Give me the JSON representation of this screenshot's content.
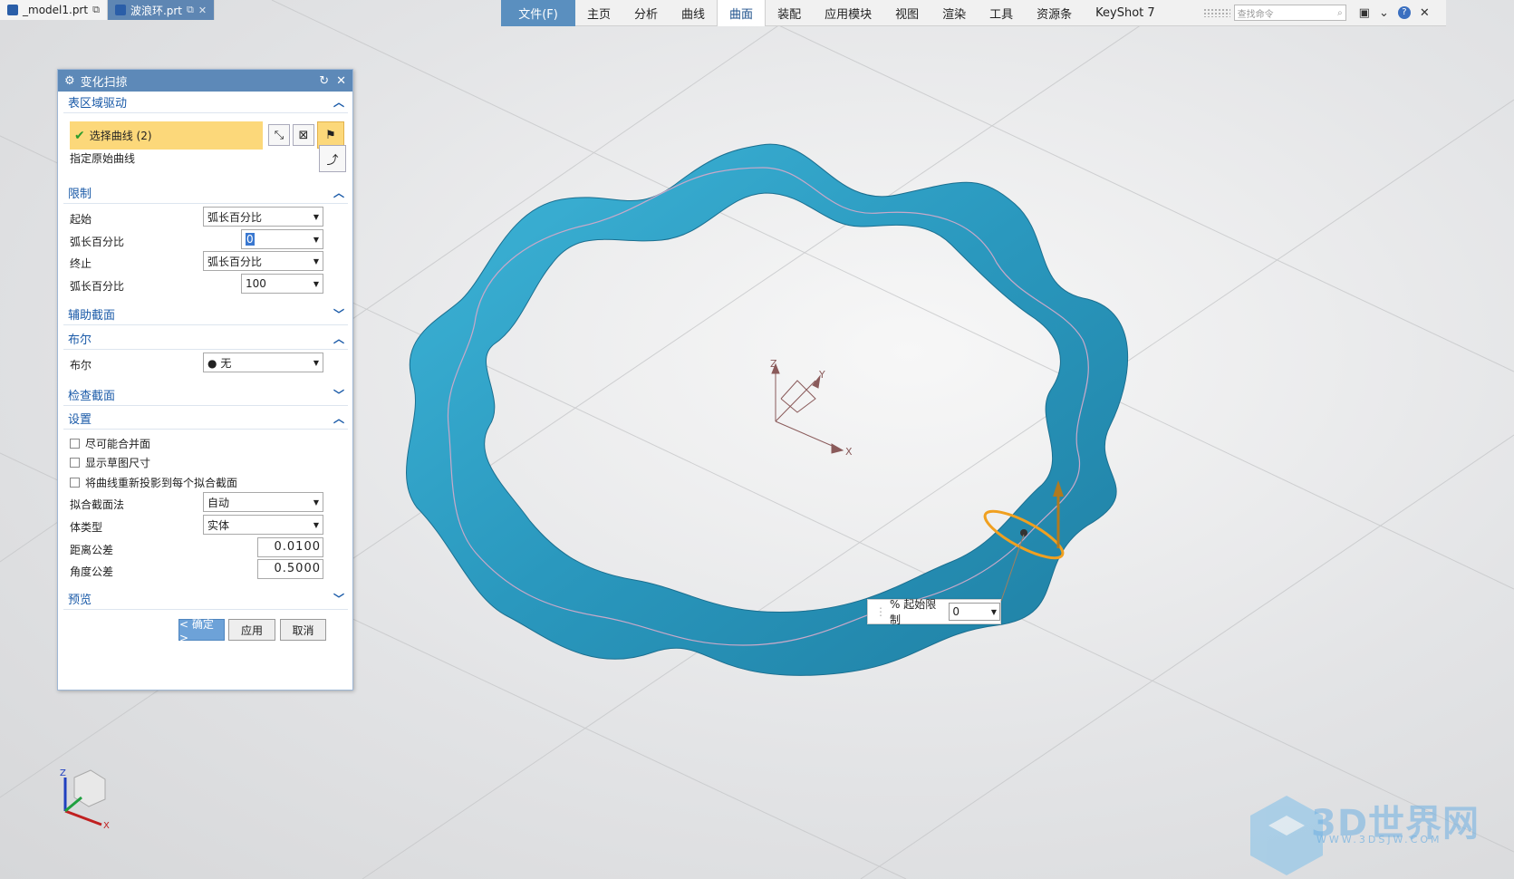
{
  "doc_tabs": [
    {
      "label": "_model1.prt"
    },
    {
      "label": "波浪环.prt"
    }
  ],
  "ribbon": {
    "file": "文件(F)",
    "tabs": [
      "主页",
      "分析",
      "曲线",
      "曲面",
      "装配",
      "应用模块",
      "视图",
      "渲染",
      "工具",
      "资源条",
      "KeyShot 7"
    ],
    "active": "曲面",
    "search_placeholder": "查找命令"
  },
  "dialog": {
    "title": "变化扫掠",
    "sections": {
      "drive": {
        "label": "表区域驱动",
        "select_curve": "选择曲线 (2)",
        "origin_curve": "指定原始曲线"
      },
      "limits": {
        "label": "限制",
        "start": "起始",
        "start_mode": "弧长百分比",
        "arc1": "弧长百分比",
        "arc1_value": "0",
        "end": "终止",
        "end_mode": "弧长百分比",
        "arc2": "弧长百分比",
        "arc2_value": "100"
      },
      "aux": {
        "label": "辅助截面"
      },
      "boolean": {
        "label": "布尔",
        "row": "布尔",
        "value": "无"
      },
      "check": {
        "label": "检查截面"
      },
      "settings": {
        "label": "设置",
        "cb1": "尽可能合并面",
        "cb2": "显示草图尺寸",
        "cb3": "将曲线重新投影到每个拟合截面",
        "fit": "拟合截面法",
        "fit_value": "自动",
        "body": "体类型",
        "body_value": "实体",
        "dist": "距离公差",
        "dist_value": "0.0100",
        "ang": "角度公差",
        "ang_value": "0.5000"
      },
      "preview": {
        "label": "预览"
      }
    },
    "buttons": {
      "ok": "< 确定 >",
      "apply": "应用",
      "cancel": "取消"
    }
  },
  "float_input": {
    "label": "% 起始限制",
    "value": "0"
  },
  "axes": {
    "x": "X",
    "y": "Y",
    "z": "Z"
  },
  "watermark": {
    "title": "3D世界网",
    "url": "WWW.3DSJW.COM"
  },
  "colors": {
    "ring": "#2fa3c7",
    "accent": "#5d89b8"
  }
}
